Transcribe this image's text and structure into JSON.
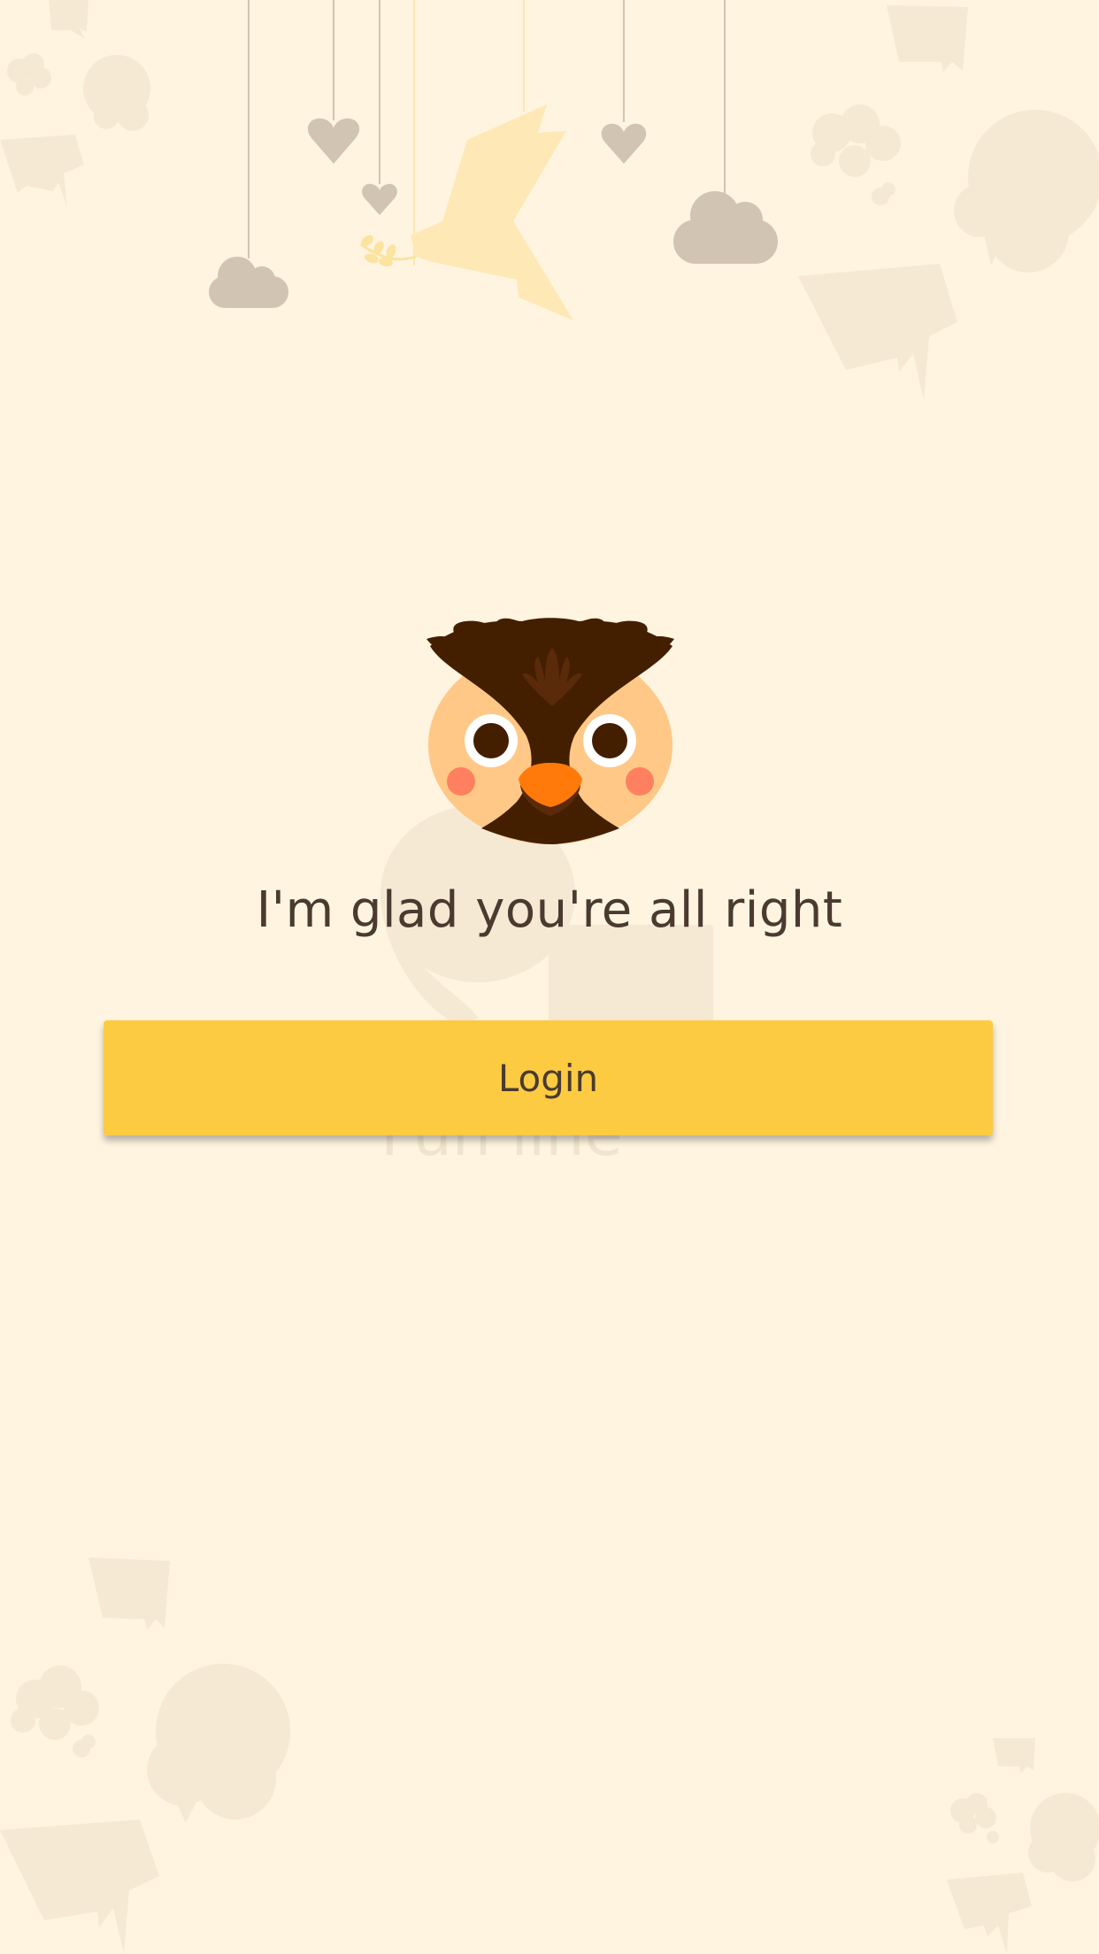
{
  "screen": {
    "headline": "I'm glad you're all right",
    "login_label": "Login"
  },
  "colors": {
    "background": "#FEF4E0",
    "button": "#FCCB42",
    "text": "#4A3A2F",
    "owl_brown": "#431F00",
    "owl_face": "#FFC886",
    "owl_beak": "#FF7A0A",
    "owl_cheek": "#FF8060",
    "hanging_ornaments": "#D2C4B2",
    "origami_bird": "#FEE9B6",
    "background_doodles": "#F5E9D4"
  },
  "icons": [
    "owl-mascot-icon",
    "origami-bird-icon",
    "hanging-heart-icon",
    "hanging-cloud-icon",
    "speech-bubble-icon",
    "hand-icon"
  ]
}
